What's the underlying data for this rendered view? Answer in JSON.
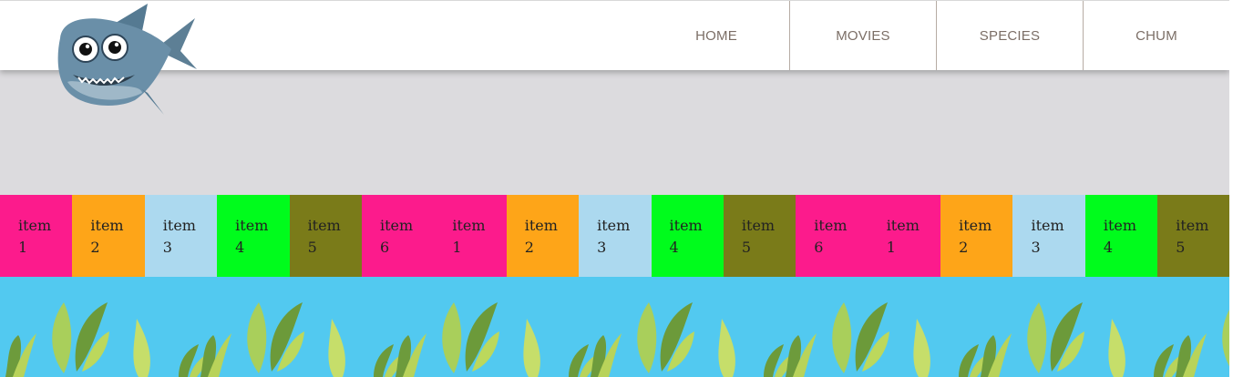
{
  "nav": {
    "items": [
      {
        "label": "HOME"
      },
      {
        "label": "MOVIES"
      },
      {
        "label": "SPECIES"
      },
      {
        "label": "CHUM"
      }
    ]
  },
  "strip": {
    "items": [
      {
        "label": "item",
        "number": "1",
        "color": "#fc1b8c"
      },
      {
        "label": "item",
        "number": "2",
        "color": "#fea518"
      },
      {
        "label": "item",
        "number": "3",
        "color": "#acd9ef"
      },
      {
        "label": "item",
        "number": "4",
        "color": "#00fc1c"
      },
      {
        "label": "item",
        "number": "5",
        "color": "#7a7b19"
      },
      {
        "label": "item",
        "number": "6",
        "color": "#fc1b8c"
      },
      {
        "label": "item",
        "number": "1",
        "color": "#fc1b8c"
      },
      {
        "label": "item",
        "number": "2",
        "color": "#fea518"
      },
      {
        "label": "item",
        "number": "3",
        "color": "#acd9ef"
      },
      {
        "label": "item",
        "number": "4",
        "color": "#00fc1c"
      },
      {
        "label": "item",
        "number": "5",
        "color": "#7a7b19"
      },
      {
        "label": "item",
        "number": "6",
        "color": "#fc1b8c"
      },
      {
        "label": "item",
        "number": "1",
        "color": "#fc1b8c"
      },
      {
        "label": "item",
        "number": "2",
        "color": "#fea518"
      },
      {
        "label": "item",
        "number": "3",
        "color": "#acd9ef"
      },
      {
        "label": "item",
        "number": "4",
        "color": "#00fc1c"
      },
      {
        "label": "item",
        "number": "5",
        "color": "#7a7b19"
      }
    ]
  },
  "colors": {
    "hero": "#dcdbde",
    "sea": "#52c9f0",
    "nav_text": "#7b6e66"
  },
  "icons": {
    "logo": "shark-icon",
    "seaweed": "seaweed-icon"
  }
}
